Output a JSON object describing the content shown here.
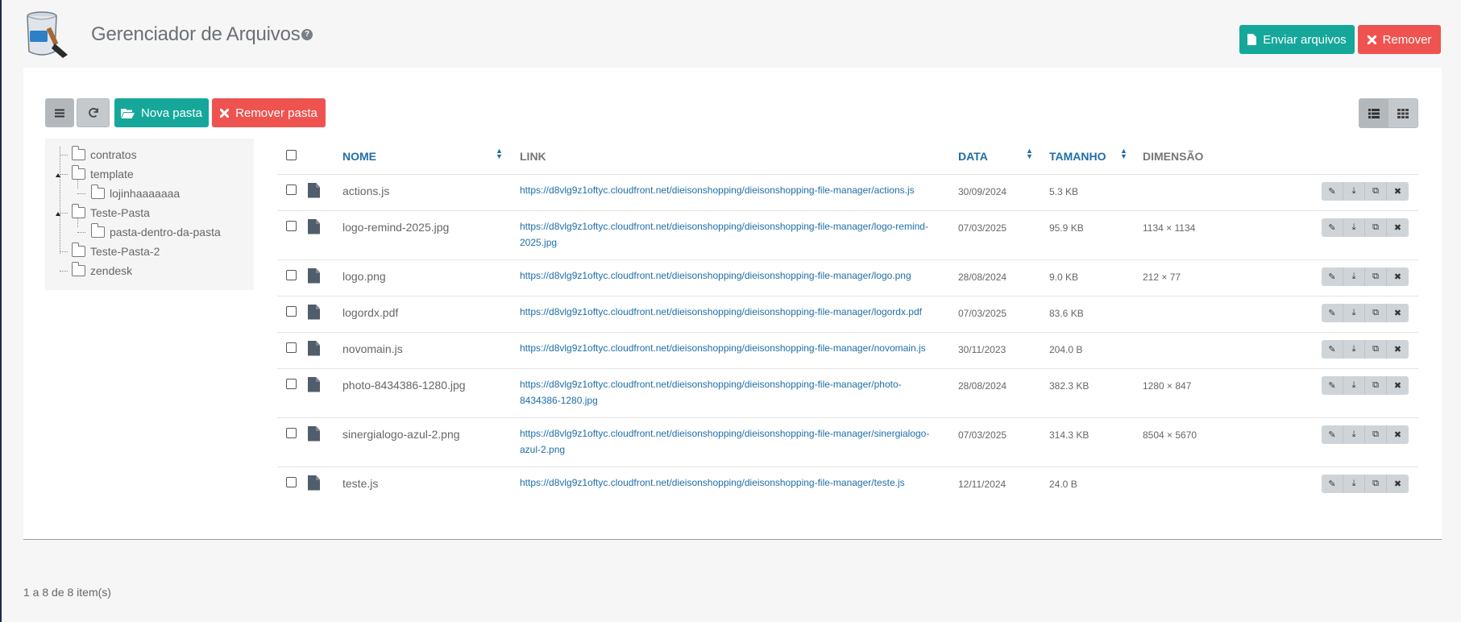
{
  "header": {
    "title": "Gerenciador de Arquivos",
    "help_symbol": "?",
    "upload_label": "Enviar arquivos",
    "remove_label": "Remover"
  },
  "toolbar": {
    "new_folder_label": "Nova pasta",
    "remove_folder_label": "Remover pasta"
  },
  "tree": [
    {
      "label": "contratos",
      "level": 0
    },
    {
      "label": "template",
      "level": 0
    },
    {
      "label": "lojinhaaaaaaa",
      "level": 1
    },
    {
      "label": "Teste-Pasta",
      "level": 0
    },
    {
      "label": "pasta-dentro-da-pasta",
      "level": 1
    },
    {
      "label": "Teste-Pasta-2",
      "level": 0
    },
    {
      "label": "zendesk",
      "level": 0
    }
  ],
  "table": {
    "headers": {
      "name": "NOME",
      "link": "LINK",
      "date": "DATA",
      "size": "TAMANHO",
      "dimension": "DIMENSÃO"
    },
    "rows": [
      {
        "name": "actions.js",
        "link": "https://d8vlg9z1oftyc.cloudfront.net/dieisonshopping/dieisonshopping-file-manager/actions.js",
        "date": "30/09/2024",
        "size": "5.3 KB",
        "dimension": ""
      },
      {
        "name": "logo-remind-2025.jpg",
        "link": "https://d8vlg9z1oftyc.cloudfront.net/dieisonshopping/dieisonshopping-file-manager/logo-remind-2025.jpg",
        "date": "07/03/2025",
        "size": "95.9 KB",
        "dimension": "1134 × 1134"
      },
      {
        "name": "logo.png",
        "link": "https://d8vlg9z1oftyc.cloudfront.net/dieisonshopping/dieisonshopping-file-manager/logo.png",
        "date": "28/08/2024",
        "size": "9.0 KB",
        "dimension": "212 × 77"
      },
      {
        "name": "logordx.pdf",
        "link": "https://d8vlg9z1oftyc.cloudfront.net/dieisonshopping/dieisonshopping-file-manager/logordx.pdf",
        "date": "07/03/2025",
        "size": "83.6 KB",
        "dimension": ""
      },
      {
        "name": "novomain.js",
        "link": "https://d8vlg9z1oftyc.cloudfront.net/dieisonshopping/dieisonshopping-file-manager/novomain.js",
        "date": "30/11/2023",
        "size": "204.0 B",
        "dimension": ""
      },
      {
        "name": "photo-8434386-1280.jpg",
        "link": "https://d8vlg9z1oftyc.cloudfront.net/dieisonshopping/dieisonshopping-file-manager/photo-8434386-1280.jpg",
        "date": "28/08/2024",
        "size": "382.3 KB",
        "dimension": "1280 × 847"
      },
      {
        "name": "sinergialogo-azul-2.png",
        "link": "https://d8vlg9z1oftyc.cloudfront.net/dieisonshopping/dieisonshopping-file-manager/sinergialogo-azul-2.png",
        "date": "07/03/2025",
        "size": "314.3 KB",
        "dimension": "8504 × 5670"
      },
      {
        "name": "teste.js",
        "link": "https://d8vlg9z1oftyc.cloudfront.net/dieisonshopping/dieisonshopping-file-manager/teste.js",
        "date": "12/11/2024",
        "size": "24.0 B",
        "dimension": ""
      }
    ]
  },
  "footer": {
    "count_text": "1 a 8 de 8 item(s)"
  },
  "colors": {
    "teal": "#15a89a",
    "red": "#ef5350",
    "link_blue": "#1f6ea8"
  },
  "icons": [
    "paint-bucket-logo-icon",
    "question-circle-icon",
    "file-icon",
    "times-icon",
    "menu-icon",
    "refresh-icon",
    "folder-open-icon",
    "folder-icon",
    "list-view-icon",
    "grid-view-icon",
    "pencil-icon",
    "download-icon",
    "copy-icon",
    "sort-icon"
  ]
}
